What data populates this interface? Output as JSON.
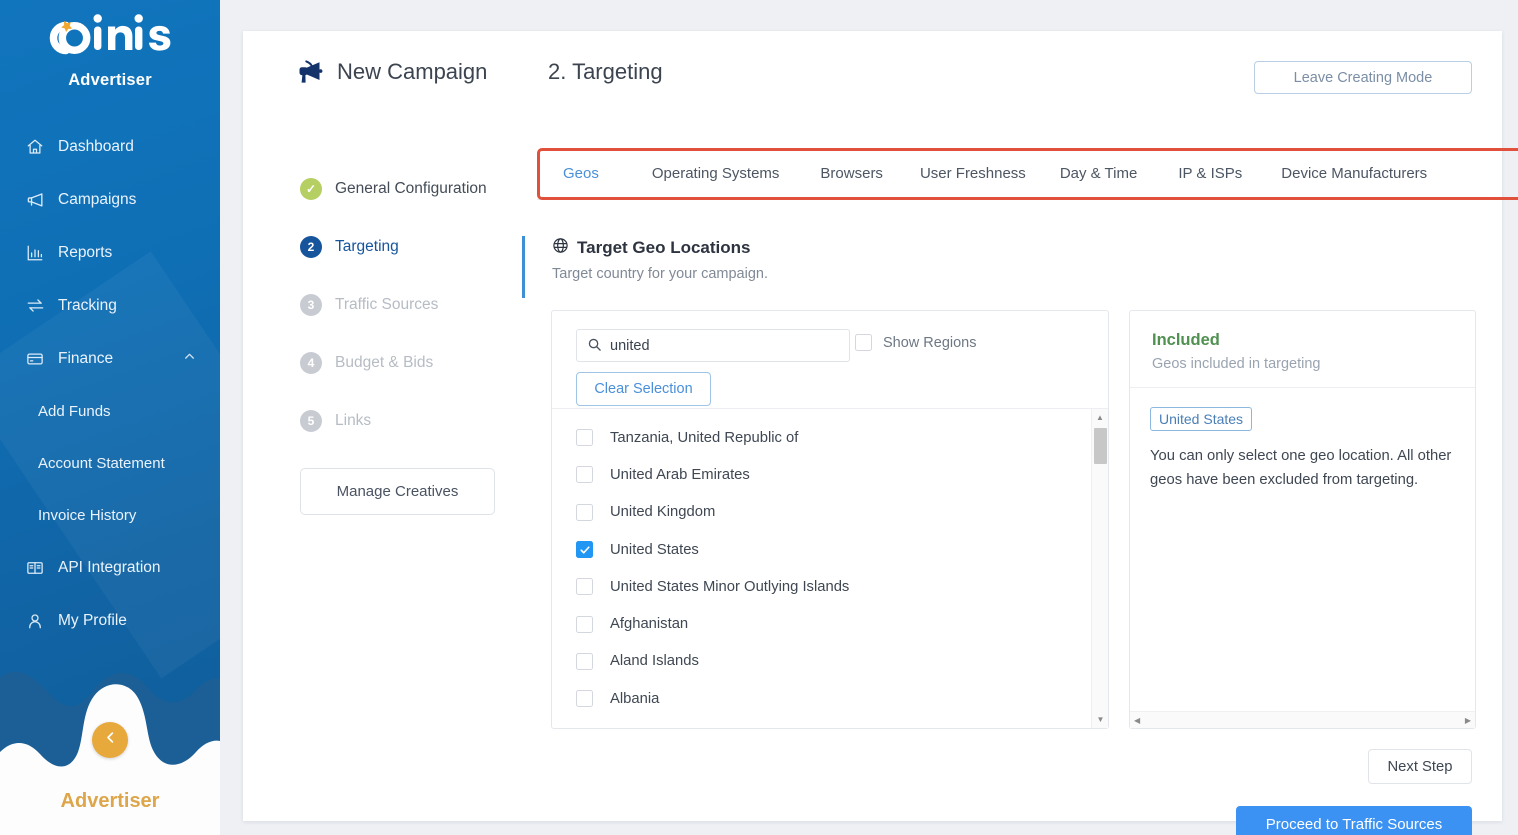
{
  "sidebar": {
    "logo_text": "coinis",
    "logo_subtitle": "Advertiser",
    "footer_label": "Advertiser",
    "collapse_icon": "chevron-left-icon",
    "items": [
      {
        "label": "Dashboard",
        "icon": "home-icon",
        "type": "main"
      },
      {
        "label": "Campaigns",
        "icon": "megaphone-icon",
        "type": "main"
      },
      {
        "label": "Reports",
        "icon": "bar-chart-icon",
        "type": "main"
      },
      {
        "label": "Tracking",
        "icon": "exchange-arrows-icon",
        "type": "main"
      },
      {
        "label": "Finance",
        "icon": "credit-card-icon",
        "type": "main",
        "expanded": true,
        "chevron": "chevron-up-icon"
      },
      {
        "label": "Add Funds",
        "icon": "",
        "type": "sub"
      },
      {
        "label": "Account Statement",
        "icon": "",
        "type": "sub"
      },
      {
        "label": "Invoice History",
        "icon": "",
        "type": "sub"
      },
      {
        "label": "API Integration",
        "icon": "book-icon",
        "type": "main"
      },
      {
        "label": "My Profile",
        "icon": "user-icon",
        "type": "main"
      }
    ]
  },
  "header": {
    "icon": "megaphone-icon",
    "title": "New Campaign",
    "step_title": "2. Targeting",
    "leave_button": "Leave Creating Mode"
  },
  "steps": [
    {
      "label": "General Configuration",
      "bullet": "✓",
      "state": "done"
    },
    {
      "label": "Targeting",
      "bullet": "2",
      "state": "active"
    },
    {
      "label": "Traffic Sources",
      "bullet": "3",
      "state": "todo"
    },
    {
      "label": "Budget & Bids",
      "bullet": "4",
      "state": "todo"
    },
    {
      "label": "Links",
      "bullet": "5",
      "state": "todo"
    }
  ],
  "manage_creatives_button": "Manage Creatives",
  "tabs": [
    {
      "label": "Geos",
      "active": true
    },
    {
      "label": "Operating Systems",
      "active": false
    },
    {
      "label": "Browsers",
      "active": false
    },
    {
      "label": "User Freshness",
      "active": false
    },
    {
      "label": "Day & Time",
      "active": false
    },
    {
      "label": "IP & ISPs",
      "active": false
    },
    {
      "label": "Device Manufacturers",
      "active": false
    }
  ],
  "geo": {
    "icon": "globe-icon",
    "title": "Target Geo Locations",
    "subtitle": "Target country for your campaign.",
    "search": {
      "value": "united",
      "placeholder": "Search",
      "icon": "search-icon"
    },
    "clear_button": "Clear Selection",
    "show_regions": {
      "label": "Show Regions",
      "checked": false
    },
    "countries": [
      {
        "name": "Tanzania, United Republic of",
        "checked": false
      },
      {
        "name": "United Arab Emirates",
        "checked": false
      },
      {
        "name": "United Kingdom",
        "checked": false
      },
      {
        "name": "United States",
        "checked": true
      },
      {
        "name": "United States Minor Outlying Islands",
        "checked": false
      },
      {
        "name": "Afghanistan",
        "checked": false
      },
      {
        "name": "Aland Islands",
        "checked": false
      },
      {
        "name": "Albania",
        "checked": false
      }
    ]
  },
  "included": {
    "title": "Included",
    "subtitle": "Geos included in targeting",
    "chips": [
      "United States"
    ],
    "note": "You can only select one geo location. All other geos have been excluded from targeting."
  },
  "footer": {
    "next_step_button": "Next Step",
    "proceed_button": "Proceed to Traffic Sources"
  },
  "colors": {
    "sidebar_blue": "#1175bd",
    "accent_blue": "#3b92f2",
    "active_step": "#16549b",
    "done_green": "#b6cf63",
    "included_green": "#509050",
    "highlight_red": "#e0503a",
    "collapse_orange": "#e8a93c"
  }
}
